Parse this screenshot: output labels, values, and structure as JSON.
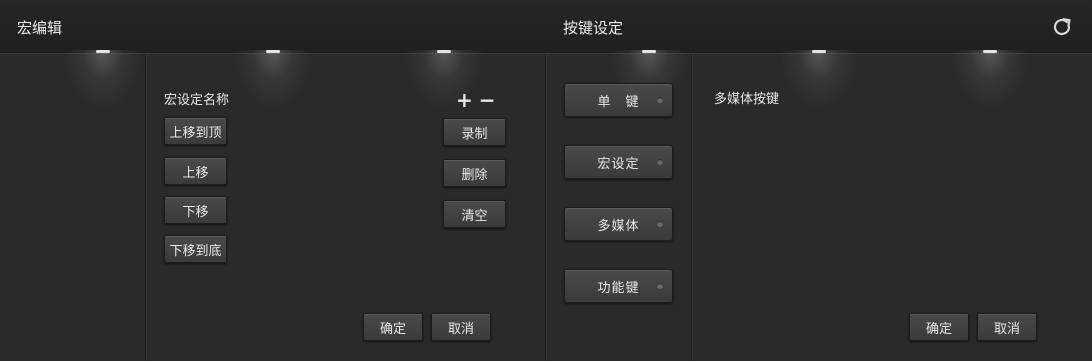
{
  "macro_editor": {
    "title": "宏编辑",
    "macro_name_label": "宏设定名称",
    "plus": "+",
    "minus": "−",
    "move_buttons": [
      "上移到顶",
      "上移",
      "下移",
      "下移到底"
    ],
    "action_buttons": [
      "录制",
      "删除",
      "清空"
    ],
    "confirm": "确定",
    "cancel": "取消"
  },
  "key_settings": {
    "title": "按键设定",
    "side_buttons": [
      "单　键",
      "宏设定",
      "多媒体",
      "功能键"
    ],
    "section_label": "多媒体按键",
    "confirm": "确定",
    "cancel": "取消",
    "refresh_icon": "refresh-icon"
  }
}
